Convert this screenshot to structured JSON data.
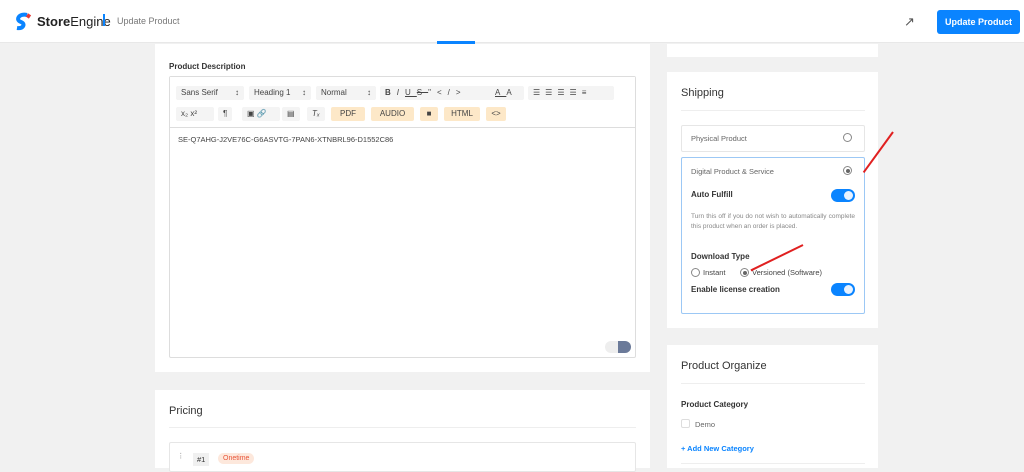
{
  "header": {
    "brand_bold": "Store",
    "brand_rest": "Engine",
    "breadcrumb": "Update Product",
    "update_button": "Update Product"
  },
  "description": {
    "label": "Product Description",
    "toolbar": {
      "font": "Sans Serif",
      "heading": "Heading 1",
      "size": "Normal",
      "pdf": "PDF",
      "audio": "AUDIO",
      "html": "HTML",
      "code": "<>"
    },
    "content": "SE-Q7AHG-J2VE76C-G6ASVTG-7PAN6-XTNBRL96-D1552C86"
  },
  "pricing": {
    "title": "Pricing",
    "index": "#1",
    "badge": "Onetime"
  },
  "shipping": {
    "title": "Shipping",
    "physical": "Physical Product",
    "digital": "Digital Product & Service",
    "selected": "digital",
    "auto_fulfill": "Auto Fulfill",
    "auto_fulfill_on": true,
    "help": "Turn this off if you do not wish to automatically complete this product when an order is placed.",
    "download_type": "Download Type",
    "instant": "Instant",
    "versioned": "Versioned (Software)",
    "download_selected": "versioned",
    "license": "Enable license creation",
    "license_on": true
  },
  "organize": {
    "title": "Product Organize",
    "category_label": "Product Category",
    "categories": [
      "Demo"
    ],
    "add_category": "+ Add New Category"
  },
  "colors": {
    "accent": "#0a84ff",
    "annotation": "#e02020"
  }
}
